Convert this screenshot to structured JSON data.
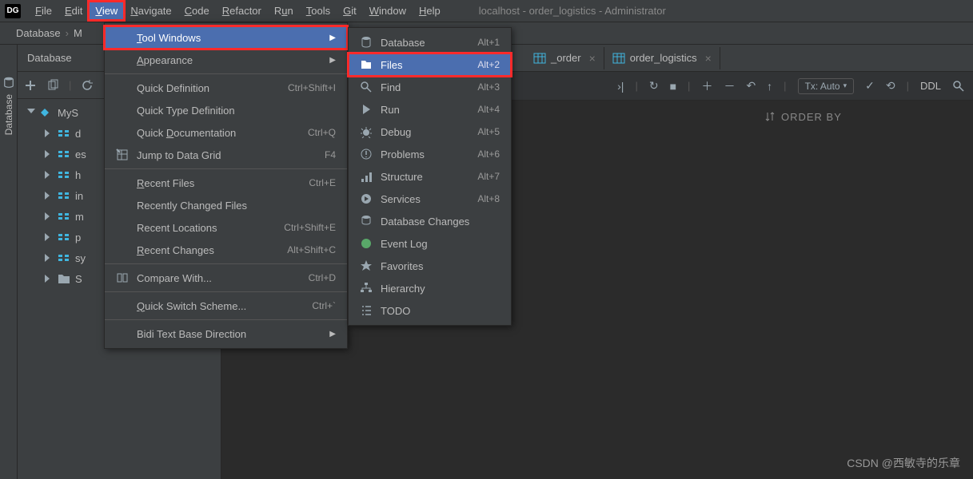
{
  "title": "localhost - order_logistics - Administrator",
  "menubar": [
    {
      "label": "File",
      "u": "F"
    },
    {
      "label": "Edit",
      "u": "E"
    },
    {
      "label": "View",
      "u": "V",
      "open": true,
      "red": true
    },
    {
      "label": "Navigate",
      "u": "N"
    },
    {
      "label": "Code",
      "u": "C"
    },
    {
      "label": "Refactor",
      "u": "R"
    },
    {
      "label": "Run",
      "u": "u"
    },
    {
      "label": "Tools",
      "u": "T"
    },
    {
      "label": "Git",
      "u": "G"
    },
    {
      "label": "Window",
      "u": "W"
    },
    {
      "label": "Help",
      "u": "H"
    }
  ],
  "breadcrumb": {
    "a": "Database",
    "b": "M"
  },
  "side": {
    "label": "Database"
  },
  "db_panel": {
    "header": "Database"
  },
  "tree": {
    "root": "MyS",
    "children": [
      {
        "label": "d"
      },
      {
        "label": "es"
      },
      {
        "label": "h"
      },
      {
        "label": "in"
      },
      {
        "label": "m"
      },
      {
        "label": "p"
      },
      {
        "label": "sy"
      },
      {
        "label": "S",
        "folder": true
      }
    ]
  },
  "view_menu": [
    {
      "label": "Tool Windows",
      "u": "T",
      "hl": true,
      "red": true,
      "sub": true
    },
    {
      "label": "Appearance",
      "u": "A",
      "sub": true
    },
    {
      "sep": true
    },
    {
      "label": "Quick Definition",
      "sc": "Ctrl+Shift+I"
    },
    {
      "label": "Quick Type Definition"
    },
    {
      "label": "Quick Documentation",
      "u": "D",
      "sc": "Ctrl+Q"
    },
    {
      "icon": "grid",
      "label": "Jump to Data Grid",
      "sc": "F4"
    },
    {
      "sep": true
    },
    {
      "label": "Recent Files",
      "u": "R",
      "sc": "Ctrl+E"
    },
    {
      "label": "Recently Changed Files"
    },
    {
      "label": "Recent Locations",
      "sc": "Ctrl+Shift+E"
    },
    {
      "label": "Recent Changes",
      "u": "R",
      "sc": "Alt+Shift+C"
    },
    {
      "sep": true
    },
    {
      "icon": "compare",
      "label": "Compare With...",
      "sc": "Ctrl+D"
    },
    {
      "sep": true
    },
    {
      "label": "Quick Switch Scheme...",
      "u": "Q",
      "sc": "Ctrl+`"
    },
    {
      "sep": true
    },
    {
      "label": "Bidi Text Base Direction",
      "sub": true
    }
  ],
  "tools_menu": [
    {
      "icon": "db",
      "label": "Database",
      "sc": "Alt+1"
    },
    {
      "icon": "folder",
      "label": "Files",
      "sc": "Alt+2",
      "hl": true,
      "red": true
    },
    {
      "icon": "search",
      "label": "Find",
      "sc": "Alt+3"
    },
    {
      "icon": "play",
      "label": "Run",
      "sc": "Alt+4"
    },
    {
      "icon": "bug",
      "label": "Debug",
      "sc": "Alt+5"
    },
    {
      "icon": "warn",
      "label": "Problems",
      "sc": "Alt+6"
    },
    {
      "icon": "struct",
      "label": "Structure",
      "sc": "Alt+7"
    },
    {
      "icon": "serv",
      "label": "Services",
      "sc": "Alt+8"
    },
    {
      "icon": "dbch",
      "label": "Database Changes"
    },
    {
      "icon": "event",
      "label": "Event Log"
    },
    {
      "icon": "star",
      "label": "Favorites"
    },
    {
      "icon": "hier",
      "label": "Hierarchy"
    },
    {
      "icon": "todo",
      "label": "TODO"
    }
  ],
  "tabs": [
    {
      "icon": "table",
      "label": "_order"
    },
    {
      "icon": "table",
      "label": "order_logistics",
      "active": true
    }
  ],
  "ed_toolbar": {
    "tx": "Tx: Auto",
    "ddl": "DDL"
  },
  "query": {
    "order_by": "ORDER BY"
  },
  "watermark": "CSDN @西敏寺的乐章"
}
